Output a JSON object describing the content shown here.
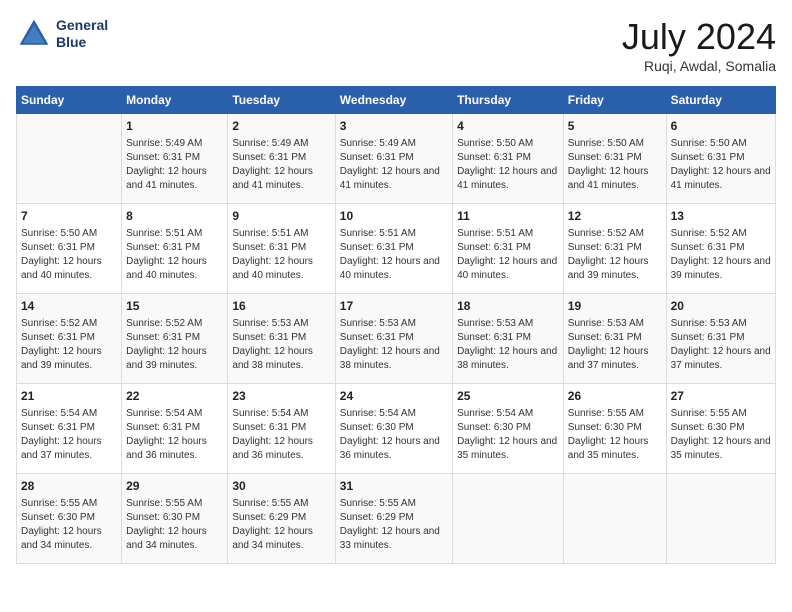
{
  "header": {
    "logo_line1": "General",
    "logo_line2": "Blue",
    "title": "July 2024",
    "subtitle": "Ruqi, Awdal, Somalia"
  },
  "days_of_week": [
    "Sunday",
    "Monday",
    "Tuesday",
    "Wednesday",
    "Thursday",
    "Friday",
    "Saturday"
  ],
  "weeks": [
    [
      {
        "day": "",
        "sunrise": "",
        "sunset": "",
        "daylight": ""
      },
      {
        "day": "1",
        "sunrise": "Sunrise: 5:49 AM",
        "sunset": "Sunset: 6:31 PM",
        "daylight": "Daylight: 12 hours and 41 minutes."
      },
      {
        "day": "2",
        "sunrise": "Sunrise: 5:49 AM",
        "sunset": "Sunset: 6:31 PM",
        "daylight": "Daylight: 12 hours and 41 minutes."
      },
      {
        "day": "3",
        "sunrise": "Sunrise: 5:49 AM",
        "sunset": "Sunset: 6:31 PM",
        "daylight": "Daylight: 12 hours and 41 minutes."
      },
      {
        "day": "4",
        "sunrise": "Sunrise: 5:50 AM",
        "sunset": "Sunset: 6:31 PM",
        "daylight": "Daylight: 12 hours and 41 minutes."
      },
      {
        "day": "5",
        "sunrise": "Sunrise: 5:50 AM",
        "sunset": "Sunset: 6:31 PM",
        "daylight": "Daylight: 12 hours and 41 minutes."
      },
      {
        "day": "6",
        "sunrise": "Sunrise: 5:50 AM",
        "sunset": "Sunset: 6:31 PM",
        "daylight": "Daylight: 12 hours and 41 minutes."
      }
    ],
    [
      {
        "day": "7",
        "sunrise": "Sunrise: 5:50 AM",
        "sunset": "Sunset: 6:31 PM",
        "daylight": "Daylight: 12 hours and 40 minutes."
      },
      {
        "day": "8",
        "sunrise": "Sunrise: 5:51 AM",
        "sunset": "Sunset: 6:31 PM",
        "daylight": "Daylight: 12 hours and 40 minutes."
      },
      {
        "day": "9",
        "sunrise": "Sunrise: 5:51 AM",
        "sunset": "Sunset: 6:31 PM",
        "daylight": "Daylight: 12 hours and 40 minutes."
      },
      {
        "day": "10",
        "sunrise": "Sunrise: 5:51 AM",
        "sunset": "Sunset: 6:31 PM",
        "daylight": "Daylight: 12 hours and 40 minutes."
      },
      {
        "day": "11",
        "sunrise": "Sunrise: 5:51 AM",
        "sunset": "Sunset: 6:31 PM",
        "daylight": "Daylight: 12 hours and 40 minutes."
      },
      {
        "day": "12",
        "sunrise": "Sunrise: 5:52 AM",
        "sunset": "Sunset: 6:31 PM",
        "daylight": "Daylight: 12 hours and 39 minutes."
      },
      {
        "day": "13",
        "sunrise": "Sunrise: 5:52 AM",
        "sunset": "Sunset: 6:31 PM",
        "daylight": "Daylight: 12 hours and 39 minutes."
      }
    ],
    [
      {
        "day": "14",
        "sunrise": "Sunrise: 5:52 AM",
        "sunset": "Sunset: 6:31 PM",
        "daylight": "Daylight: 12 hours and 39 minutes."
      },
      {
        "day": "15",
        "sunrise": "Sunrise: 5:52 AM",
        "sunset": "Sunset: 6:31 PM",
        "daylight": "Daylight: 12 hours and 39 minutes."
      },
      {
        "day": "16",
        "sunrise": "Sunrise: 5:53 AM",
        "sunset": "Sunset: 6:31 PM",
        "daylight": "Daylight: 12 hours and 38 minutes."
      },
      {
        "day": "17",
        "sunrise": "Sunrise: 5:53 AM",
        "sunset": "Sunset: 6:31 PM",
        "daylight": "Daylight: 12 hours and 38 minutes."
      },
      {
        "day": "18",
        "sunrise": "Sunrise: 5:53 AM",
        "sunset": "Sunset: 6:31 PM",
        "daylight": "Daylight: 12 hours and 38 minutes."
      },
      {
        "day": "19",
        "sunrise": "Sunrise: 5:53 AM",
        "sunset": "Sunset: 6:31 PM",
        "daylight": "Daylight: 12 hours and 37 minutes."
      },
      {
        "day": "20",
        "sunrise": "Sunrise: 5:53 AM",
        "sunset": "Sunset: 6:31 PM",
        "daylight": "Daylight: 12 hours and 37 minutes."
      }
    ],
    [
      {
        "day": "21",
        "sunrise": "Sunrise: 5:54 AM",
        "sunset": "Sunset: 6:31 PM",
        "daylight": "Daylight: 12 hours and 37 minutes."
      },
      {
        "day": "22",
        "sunrise": "Sunrise: 5:54 AM",
        "sunset": "Sunset: 6:31 PM",
        "daylight": "Daylight: 12 hours and 36 minutes."
      },
      {
        "day": "23",
        "sunrise": "Sunrise: 5:54 AM",
        "sunset": "Sunset: 6:31 PM",
        "daylight": "Daylight: 12 hours and 36 minutes."
      },
      {
        "day": "24",
        "sunrise": "Sunrise: 5:54 AM",
        "sunset": "Sunset: 6:30 PM",
        "daylight": "Daylight: 12 hours and 36 minutes."
      },
      {
        "day": "25",
        "sunrise": "Sunrise: 5:54 AM",
        "sunset": "Sunset: 6:30 PM",
        "daylight": "Daylight: 12 hours and 35 minutes."
      },
      {
        "day": "26",
        "sunrise": "Sunrise: 5:55 AM",
        "sunset": "Sunset: 6:30 PM",
        "daylight": "Daylight: 12 hours and 35 minutes."
      },
      {
        "day": "27",
        "sunrise": "Sunrise: 5:55 AM",
        "sunset": "Sunset: 6:30 PM",
        "daylight": "Daylight: 12 hours and 35 minutes."
      }
    ],
    [
      {
        "day": "28",
        "sunrise": "Sunrise: 5:55 AM",
        "sunset": "Sunset: 6:30 PM",
        "daylight": "Daylight: 12 hours and 34 minutes."
      },
      {
        "day": "29",
        "sunrise": "Sunrise: 5:55 AM",
        "sunset": "Sunset: 6:30 PM",
        "daylight": "Daylight: 12 hours and 34 minutes."
      },
      {
        "day": "30",
        "sunrise": "Sunrise: 5:55 AM",
        "sunset": "Sunset: 6:29 PM",
        "daylight": "Daylight: 12 hours and 34 minutes."
      },
      {
        "day": "31",
        "sunrise": "Sunrise: 5:55 AM",
        "sunset": "Sunset: 6:29 PM",
        "daylight": "Daylight: 12 hours and 33 minutes."
      },
      {
        "day": "",
        "sunrise": "",
        "sunset": "",
        "daylight": ""
      },
      {
        "day": "",
        "sunrise": "",
        "sunset": "",
        "daylight": ""
      },
      {
        "day": "",
        "sunrise": "",
        "sunset": "",
        "daylight": ""
      }
    ]
  ]
}
